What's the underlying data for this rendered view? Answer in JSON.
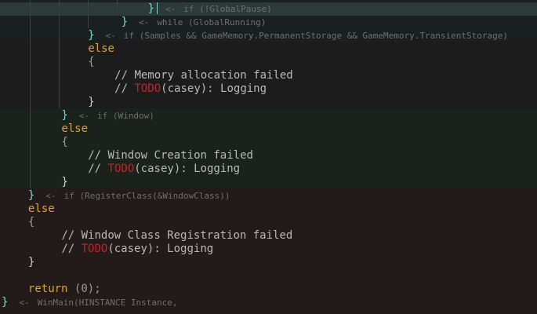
{
  "editor": {
    "lines": [
      {
        "indent": 22,
        "brace": "}",
        "annotation": "if (!GlobalPause)"
      },
      {
        "indent": 18,
        "brace": "}",
        "annotation": "while (GlobalRunning)"
      },
      {
        "indent": 13,
        "brace": "}",
        "annotation": "if (Samples && GameMemory.PermanentStorage && GameMemory.TransientStorage)"
      },
      {
        "indent": 13,
        "keyword": "else"
      },
      {
        "indent": 13,
        "brace": "{"
      },
      {
        "indent": 17,
        "comment": "// Memory allocation failed"
      },
      {
        "indent": 17,
        "comment_prefix": "// ",
        "todo": "TODO",
        "comment_suffix": "(casey): Logging"
      },
      {
        "indent": 13,
        "brace": "}"
      },
      {
        "indent": 9,
        "brace": "}",
        "annotation": "if (Window)"
      },
      {
        "indent": 9,
        "keyword": "else"
      },
      {
        "indent": 9,
        "brace": "{"
      },
      {
        "indent": 13,
        "comment": "// Window Creation failed"
      },
      {
        "indent": 13,
        "comment_prefix": "// ",
        "todo": "TODO",
        "comment_suffix": "(casey): Logging"
      },
      {
        "indent": 9,
        "brace": "}"
      },
      {
        "indent": 4,
        "brace": "}",
        "annotation": "if (RegisterClass(&WindowClass))"
      },
      {
        "indent": 4,
        "keyword": "else"
      },
      {
        "indent": 4,
        "brace": "{"
      },
      {
        "indent": 9,
        "comment": "// Window Class Registration failed"
      },
      {
        "indent": 9,
        "comment_prefix": "// ",
        "todo": "TODO",
        "comment_suffix": "(casey): Logging"
      },
      {
        "indent": 4,
        "brace": "}"
      },
      {
        "indent": 0,
        "blank": true
      },
      {
        "indent": 4,
        "keyword": "return",
        "rest_open": " (",
        "number": "0",
        "rest_close": ");"
      },
      {
        "indent": 0,
        "brace": "}",
        "annotation": "WinMain(HINSTANCE Instance,"
      }
    ],
    "arrow_glyph": "<-"
  },
  "colors": {
    "background": "#1c1c1c",
    "keyword": "#d9a62c",
    "todo": "#c0262a",
    "cursor_brace": "#7fd7c9",
    "annotation": "#6f6f6f"
  }
}
